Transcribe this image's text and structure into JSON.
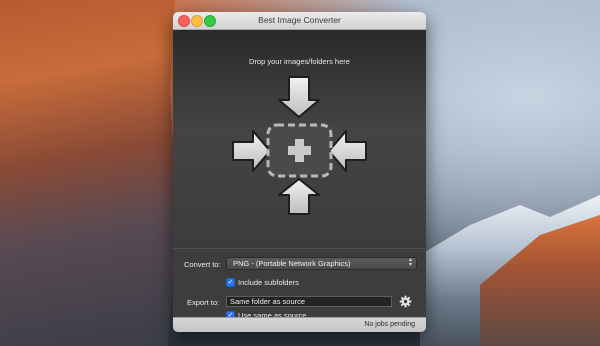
{
  "window": {
    "title": "Best Image Converter"
  },
  "drop_zone": {
    "label": "Drop your images/folders here"
  },
  "convert": {
    "label": "Convert to:",
    "selected_format": "PNG - (Portable Network Graphics)",
    "include_subfolders_label": "Include subfolders",
    "include_subfolders_checked": true
  },
  "export": {
    "label": "Export to:",
    "destination_value": "Same folder as source",
    "use_same_label": "Use same as source",
    "use_same_checked": true
  },
  "status": {
    "text": "No jobs pending"
  },
  "icons": {
    "add": "plus-icon",
    "settings": "gear-icon",
    "arrows": [
      "arrow-down-icon",
      "arrow-right-icon",
      "arrow-left-icon",
      "arrow-up-icon"
    ]
  },
  "colors": {
    "accent": "#2b73e8",
    "close": "#fc605c",
    "minimize": "#fdbc40",
    "maximize": "#34c84a"
  }
}
